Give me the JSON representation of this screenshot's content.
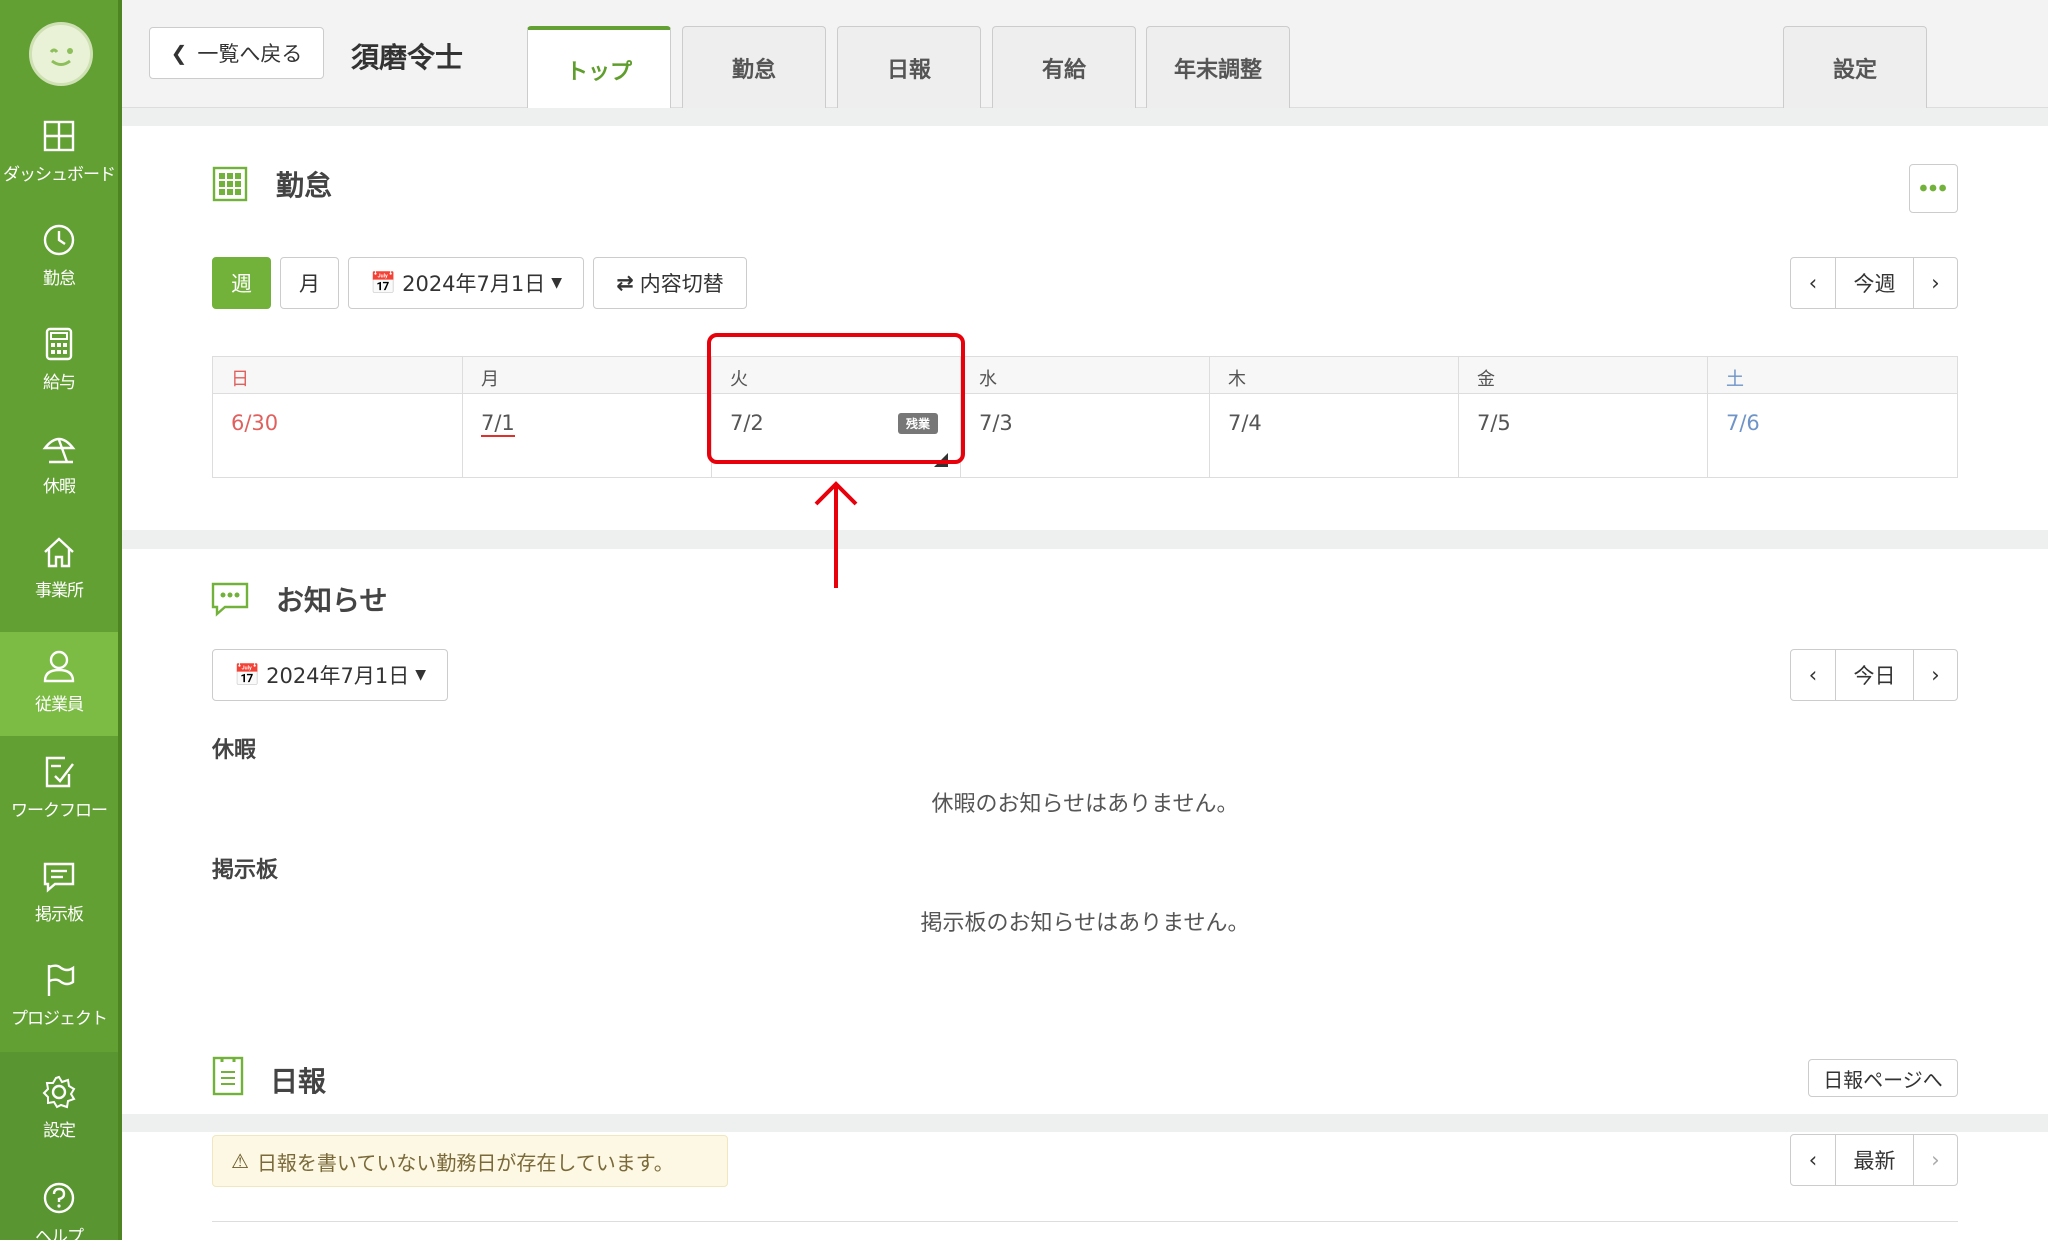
{
  "sidebar": {
    "items": [
      {
        "label": "ダッシュボード",
        "icon": "dashboard-icon"
      },
      {
        "label": "勤怠",
        "icon": "clock-icon"
      },
      {
        "label": "給与",
        "icon": "calculator-icon"
      },
      {
        "label": "休暇",
        "icon": "umbrella-icon"
      },
      {
        "label": "事業所",
        "icon": "home-icon"
      },
      {
        "label": "従業員",
        "icon": "person-icon"
      },
      {
        "label": "ワークフロー",
        "icon": "checklist-icon"
      },
      {
        "label": "掲示板",
        "icon": "chat-icon"
      },
      {
        "label": "プロジェクト",
        "icon": "flag-icon"
      },
      {
        "label": "設定",
        "icon": "gear-icon"
      },
      {
        "label": "ヘルプ",
        "icon": "help-icon"
      }
    ],
    "active_index": 5
  },
  "header": {
    "back_label": "一覧へ戻る",
    "employee_name": "須磨令士",
    "tabs": [
      {
        "label": "トップ"
      },
      {
        "label": "勤怠"
      },
      {
        "label": "日報"
      },
      {
        "label": "有給"
      },
      {
        "label": "年末調整"
      }
    ],
    "settings_tab": "設定",
    "active_tab": "トップ"
  },
  "attendance": {
    "title": "勤怠",
    "week_label": "週",
    "month_label": "月",
    "date_picker": "2024年7月1日",
    "switch_label": "内容切替",
    "today_nav": "今週",
    "days": [
      {
        "dow": "日",
        "date": "6/30"
      },
      {
        "dow": "月",
        "date": "7/1"
      },
      {
        "dow": "火",
        "date": "7/2",
        "badge": "残業"
      },
      {
        "dow": "水",
        "date": "7/3"
      },
      {
        "dow": "木",
        "date": "7/4"
      },
      {
        "dow": "金",
        "date": "7/5"
      },
      {
        "dow": "土",
        "date": "7/6"
      }
    ]
  },
  "notice": {
    "title": "お知らせ",
    "date_picker": "2024年7月1日",
    "today_nav": "今日",
    "vacation_heading": "休暇",
    "vacation_empty": "休暇のお知らせはありません。",
    "board_heading": "掲示板",
    "board_empty": "掲示板のお知らせはありません。"
  },
  "daily_report": {
    "title": "日報",
    "page_link": "日報ページへ",
    "latest_nav": "最新",
    "warning": "日報を書いていない勤務日が存在しています。"
  },
  "colors": {
    "brand_green": "#62a033",
    "sunday_red": "#e0605e",
    "saturday_blue": "#6f94c8",
    "highlight_red": "#e8000b"
  }
}
